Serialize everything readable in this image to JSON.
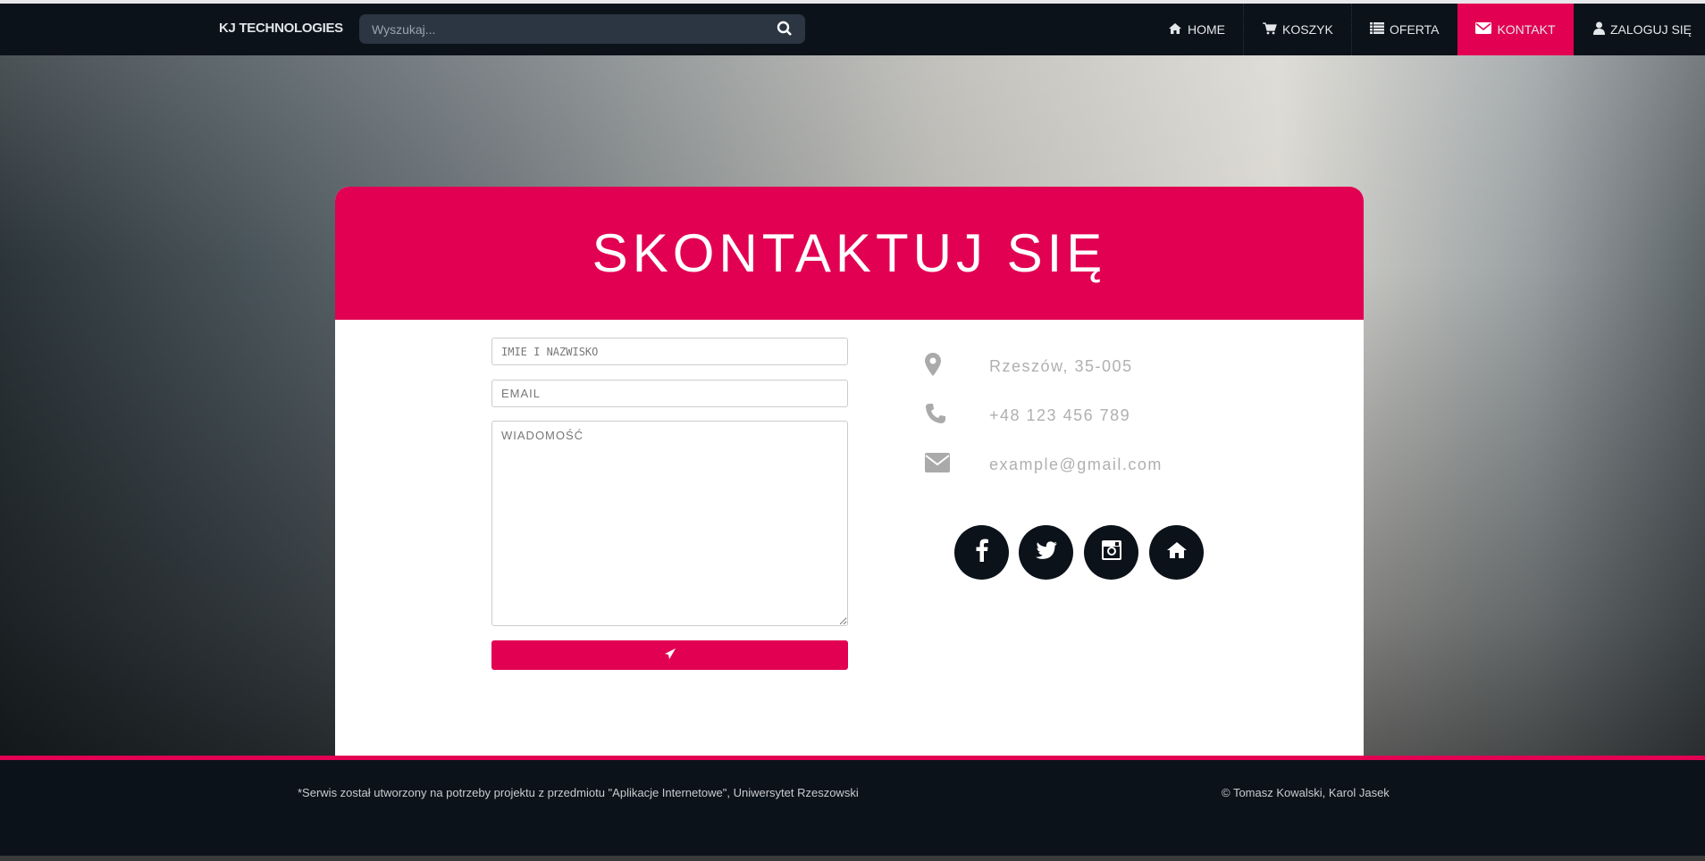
{
  "nav": {
    "brand": "KJ TECHNOLOGIES",
    "search_placeholder": "Wyszukaj...",
    "items": [
      {
        "label": "HOME",
        "icon": "home-icon"
      },
      {
        "label": "KOSZYK",
        "icon": "cart-icon"
      },
      {
        "label": "OFERTA",
        "icon": "list-icon"
      },
      {
        "label": "KONTAKT",
        "icon": "envelope-icon",
        "active": true
      },
      {
        "label": "ZALOGUJ SIĘ",
        "icon": "user-icon"
      }
    ]
  },
  "contact": {
    "title": "SKONTAKTUJ SIĘ",
    "form": {
      "name_placeholder": "IMIE I NAZWISKO",
      "email_placeholder": "EMAIL",
      "message_placeholder": "WIADOMOŚĆ",
      "send_icon": "paper-plane-icon"
    },
    "info": {
      "address": "Rzeszów, 35-005",
      "phone": "+48 123 456 789",
      "email": "example@gmail.com"
    },
    "social": [
      "facebook-icon",
      "twitter-icon",
      "instagram-icon",
      "home-icon"
    ]
  },
  "footer": {
    "note": "*Serwis został utworzony na potrzeby projektu z przedmiotu \"Aplikacje Internetowe\", Uniwersytet Rzeszowski",
    "copyright": "© Tomasz Kowalski, Karol Jasek"
  },
  "colors": {
    "accent": "#e20052",
    "dark": "#0c121a"
  }
}
